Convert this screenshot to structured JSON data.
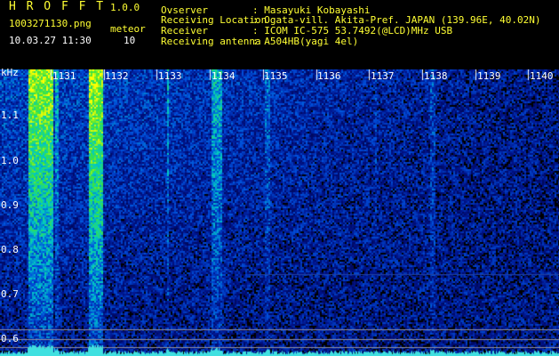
{
  "header": {
    "app_title": "H R O F F T",
    "app_version": "1.0.0",
    "file_name": "1003271130.png",
    "meteor_label": "meteor",
    "datetime": "10.03.27 11:30",
    "meteor_count": "10"
  },
  "info": [
    {
      "key": "Ovserver",
      "value": ": Masayuki Kobayashi"
    },
    {
      "key": "Receiving Location",
      "value": ": Ogata-vill. Akita-Pref. JAPAN (139.96E, 40.02N)"
    },
    {
      "key": "Receiver",
      "value": ": ICOM IC-575 53.7492(@LCD)MHz USB"
    },
    {
      "key": "Receiving antenna",
      "value": ": A504HB(yagi 4el)"
    }
  ],
  "axis": {
    "y_unit": "kHz",
    "y_ticks": [
      "1.1",
      "1.0",
      "0.9",
      "0.8",
      "0.7",
      "0.6"
    ],
    "x_ticks": [
      "1131",
      "1132",
      "1133",
      "1134",
      "1135",
      "1136",
      "1137",
      "1138",
      "1139",
      "1140"
    ]
  },
  "colors": {
    "background": "#000000",
    "accent_yellow": "#ffff33",
    "spectrum_low": "#00005a",
    "spectrum_high": "#ffff00"
  }
}
